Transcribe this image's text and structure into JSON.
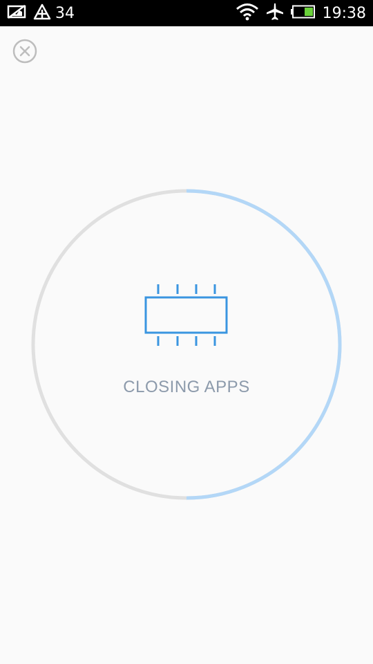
{
  "status_bar": {
    "left_icons": [
      "no-sim-icon",
      "drive-mode-icon"
    ],
    "notification_count": "34",
    "right_icons": [
      "wifi-icon",
      "airplane-mode-icon",
      "battery-icon"
    ],
    "time": "19:38"
  },
  "screen": {
    "close_icon": "close-icon",
    "center_icon": "memory-chip-icon",
    "status_label": "CLOSING APPS",
    "progress": 0.5
  },
  "colors": {
    "accent": "#3a95e0",
    "progress_track": "#e0e0e0",
    "progress_fill": "#b3d7f7",
    "label": "#8c9aab",
    "close_icon": "#bdbdbd",
    "battery_fill": "#6ad13a",
    "background": "#fafafa"
  }
}
